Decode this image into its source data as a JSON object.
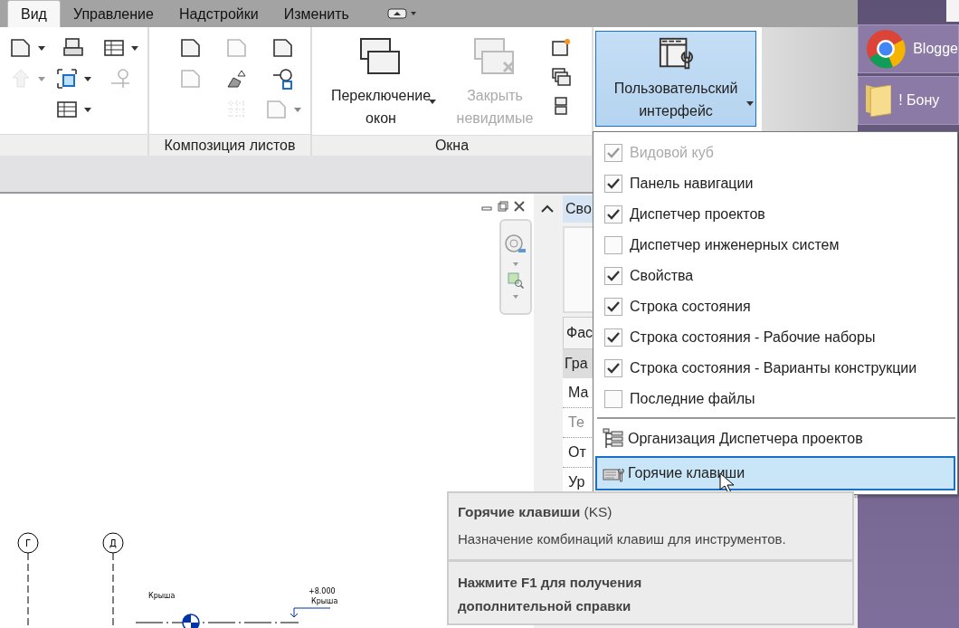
{
  "ribbon_tabs": [
    {
      "label": "Вид",
      "selected": true
    },
    {
      "label": "Управление",
      "selected": false
    },
    {
      "label": "Надстройки",
      "selected": false
    },
    {
      "label": "Изменить",
      "selected": false
    }
  ],
  "ribbon": {
    "layout_panel": {
      "label": "Композиция листов"
    },
    "windows_panel": {
      "label": "Окна",
      "buttons": [
        {
          "label": "Переключение окон",
          "disabled": false
        },
        {
          "label": "Закрыть невидимые",
          "disabled": true
        }
      ]
    },
    "ui_button": {
      "label": "Пользовательский интерфейс",
      "expanded": true
    }
  },
  "ui_menu": [
    {
      "kind": "check",
      "label": "Видовой куб",
      "checked": true,
      "disabled": true
    },
    {
      "kind": "check",
      "label": "Панель навигации",
      "checked": true,
      "disabled": false
    },
    {
      "kind": "check",
      "label": "Диспетчер проектов",
      "checked": true,
      "disabled": false
    },
    {
      "kind": "check",
      "label": "Диспетчер инженерных систем",
      "checked": false,
      "disabled": false
    },
    {
      "kind": "check",
      "label": "Свойства",
      "checked": true,
      "disabled": false
    },
    {
      "kind": "check",
      "label": "Строка состояния",
      "checked": true,
      "disabled": false
    },
    {
      "kind": "check",
      "label": "Строка состояния - Рабочие наборы",
      "checked": true,
      "disabled": false
    },
    {
      "kind": "check",
      "label": "Строка состояния - Варианты конструкции",
      "checked": true,
      "disabled": false
    },
    {
      "kind": "check",
      "label": "Последние файлы",
      "checked": false,
      "disabled": false
    },
    {
      "kind": "tree",
      "label": "Организация Диспетчера проектов",
      "selected": false
    },
    {
      "kind": "keys",
      "label": "Горячие клавиши",
      "selected": true
    }
  ],
  "properties": {
    "title": "Сво",
    "type": "Фас",
    "group": "Гра",
    "params": [
      {
        "label": "Ма",
        "disabled": false
      },
      {
        "label": "Те",
        "disabled": true
      },
      {
        "label": "От",
        "disabled": false
      },
      {
        "label": "Ур",
        "disabled": false
      }
    ]
  },
  "drawing": {
    "grids": [
      "Г",
      "Д"
    ],
    "level_left": "Крыша",
    "level_right": {
      "elevation": "+8.000",
      "name": "Крыша"
    }
  },
  "tooltip": {
    "title": "Горячие клавиши",
    "shortcut": "(KS)",
    "description": "Назначение комбинаций клавиш для инструментов.",
    "help": "Нажмите F1 для получения дополнительной справки"
  },
  "desktop": [
    {
      "kind": "browser",
      "label": "Blogge"
    },
    {
      "kind": "folder",
      "label": "! Бону"
    }
  ]
}
